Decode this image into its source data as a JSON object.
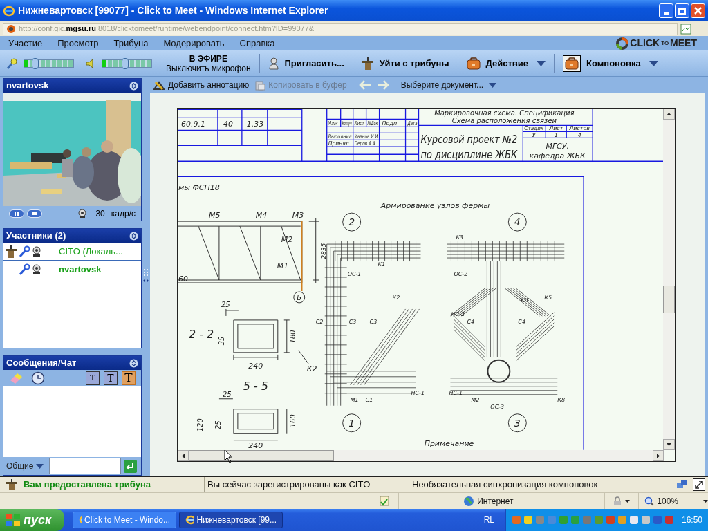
{
  "window": {
    "title": "Нижневартовск [99077] - Click to Meet - Windows Internet Explorer"
  },
  "address_bar": {
    "url": "http://conf.gic.**mgsu.ru**:8018/clicktomeet/runtime/webendpoint/connect.htm?ID=99077&"
  },
  "menu": [
    "Участие",
    "Просмотр",
    "Трибуна",
    "Модерировать",
    "Справка"
  ],
  "logo": [
    "CLICK",
    "TO",
    "MEET"
  ],
  "toolbar": {
    "mic_level": {
      "level": 0.18
    },
    "speaker_level": {
      "level": 0.45
    },
    "broadcast": {
      "status": "В ЭФИРЕ",
      "action": "Выключить микрофон"
    },
    "buttons": [
      {
        "kind": "invite",
        "label": "Пригласить...",
        "dropdown": false,
        "pressed": false
      },
      {
        "kind": "podium",
        "label": "Уйти с трибуны",
        "dropdown": false,
        "pressed": false
      },
      {
        "kind": "case",
        "label": "Действие",
        "dropdown": true,
        "pressed": false
      },
      {
        "kind": "case",
        "label": "Компоновка",
        "dropdown": true,
        "pressed": true
      }
    ]
  },
  "video_panel": {
    "title": "nvartovsk",
    "fps": "30",
    "fps_unit": "кадр/с"
  },
  "participants": {
    "title": "Участники (2)",
    "items": [
      {
        "name": "CITO (Локаль...",
        "presenter": true,
        "selected": false
      },
      {
        "name": "nvartovsk",
        "presenter": false,
        "selected": true
      }
    ]
  },
  "chat": {
    "title": "Сообщения/Чат",
    "text_sizes": [
      {
        "label": "T",
        "selected": false
      },
      {
        "label": "T",
        "selected": false
      },
      {
        "label": "T",
        "selected": true
      }
    ],
    "recipient": "Общие"
  },
  "document_toolbar": {
    "annotate": "Добавить аннотацию",
    "copy": {
      "label": "Копировать в буфер",
      "disabled": true
    },
    "back": {
      "disabled": true
    },
    "forward": {
      "disabled": true
    },
    "document_select": "Выберите документ..."
  },
  "document": {
    "table": [
      "60.9.1",
      "40",
      "1.33"
    ],
    "revision_table": [
      "Изм",
      "Кол.уч",
      "Лист",
      "№Док",
      "Подп",
      "Дата",
      "Выполнил",
      "Иванов И.И",
      "Принял",
      "Перов А.А."
    ],
    "title_block": [
      "Маркировочная схема. Спецификация",
      "Схема расположения связей",
      "Стадия",
      "Лист",
      "Листов",
      "У",
      "1",
      "4",
      "Курсовой проект №2",
      "МГСУ,",
      "по дисциплине ЖБК",
      "кафедра ЖБК"
    ],
    "sheet": [
      "мы ФСП18",
      "Армирование узлов фермы",
      "М5",
      "М4",
      "М3",
      "2",
      "4",
      "М2",
      "2835",
      "М1",
      "60",
      "Б",
      "25",
      "2 - 2",
      "35",
      "180",
      "240",
      "К2",
      "5 - 5",
      "25",
      "25",
      "120",
      "160",
      "1",
      "3",
      "240",
      "Примечание"
    ],
    "node_labels": [
      "К3",
      "К1",
      "ОС-1",
      "ОС-2",
      "К2",
      "К4",
      "К5",
      "НС-2",
      "С2",
      "С3",
      "С3",
      "С4",
      "С4",
      "НС-1",
      "НС-1",
      "М1",
      "С1",
      "М2",
      "К8",
      "ОС-3"
    ]
  },
  "status_bar": [
    "Вам предоставлена трибуна",
    "Вы сейчас зарегистрированы как CITO",
    "Необязательная синхронизация компоновок"
  ],
  "ie_status": {
    "zone": "Интернет",
    "zoom": "100%"
  },
  "taskbar": {
    "start": "пуск",
    "tasks": [
      {
        "label": "Click to Meet - Windo...",
        "selected": false
      },
      {
        "label": "Нижневартовск [99...",
        "selected": true
      }
    ],
    "language": "RL",
    "clock": "16:50"
  }
}
